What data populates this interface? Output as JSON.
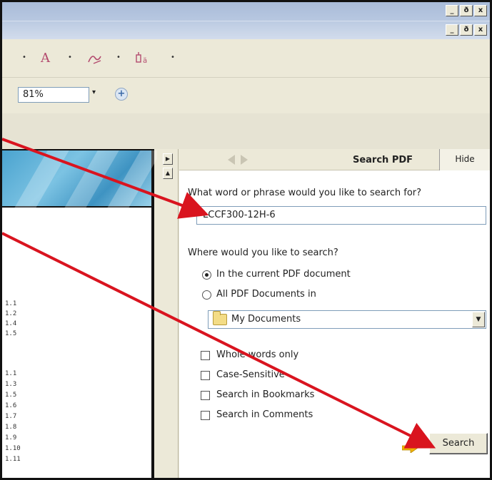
{
  "window": {
    "minimize_label": "_",
    "restore_label": "ð",
    "close_label": "x"
  },
  "toolbar": {
    "zoom_value": "81%",
    "zoom_dropdown": "▾",
    "zoom_in_label": "+",
    "text_tool": "A",
    "dd": "•"
  },
  "doc": {
    "toc_numbers_a": [
      "1.1",
      "1.2",
      "1.4",
      "1.5"
    ],
    "toc_numbers_b": [
      "1.1",
      "1.3",
      "1.5",
      "1.6",
      "1.7",
      "1.8",
      "1.9",
      "1.10",
      "1.11"
    ]
  },
  "search_panel": {
    "title": "Search PDF",
    "hide_label": "Hide",
    "question_phrase": "What word or phrase would you like to search for?",
    "search_value": "LCCF300-12H-6",
    "question_where": "Where would you like to search?",
    "options": [
      {
        "label": "In the current PDF document",
        "selected": true
      },
      {
        "label": "All PDF Documents in",
        "selected": false
      }
    ],
    "location_select": "My Documents",
    "checkboxes": [
      {
        "label": "Whole words only",
        "checked": false
      },
      {
        "label": "Case-Sensitive",
        "checked": false
      },
      {
        "label": "Search in Bookmarks",
        "checked": false
      },
      {
        "label": "Search in Comments",
        "checked": false
      }
    ],
    "search_button": "Search"
  },
  "colors": {
    "callout_arrow": "#d9141f",
    "search_arrow_icon": "#f0b400"
  }
}
